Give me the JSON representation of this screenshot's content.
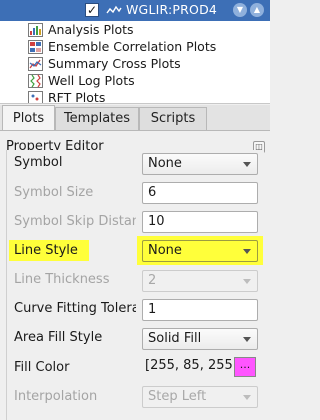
{
  "tree": {
    "selected_item": "WGLIR:PROD4",
    "selected_checked": true,
    "items": [
      {
        "label": "Analysis Plots",
        "icon": "analysis-plots-icon"
      },
      {
        "label": "Ensemble Correlation Plots",
        "icon": "correlation-plots-icon"
      },
      {
        "label": "Summary Cross Plots",
        "icon": "cross-plots-icon"
      },
      {
        "label": "Well Log Plots",
        "icon": "well-log-plots-icon"
      },
      {
        "label": "RFT Plots",
        "icon": "rft-plots-icon"
      }
    ]
  },
  "tabs": [
    {
      "label": "Plots",
      "active": true
    },
    {
      "label": "Templates",
      "active": false
    },
    {
      "label": "Scripts",
      "active": false
    }
  ],
  "property_editor": {
    "title": "Property Editor",
    "rows": {
      "symbol": {
        "label": "Symbol",
        "value": "None",
        "enabled": true
      },
      "symbol_size": {
        "label": "Symbol Size",
        "value": "6",
        "enabled": false
      },
      "symbol_skip": {
        "label": "Symbol Skip Distanc",
        "value": "10",
        "enabled": false
      },
      "line_style": {
        "label": "Line Style",
        "value": "None",
        "enabled": true,
        "highlighted": true
      },
      "line_thickness": {
        "label": "Line Thickness",
        "value": "2",
        "enabled": false
      },
      "curve_fitting": {
        "label": "Curve Fitting Toleran",
        "value": "1",
        "enabled": true
      },
      "area_fill": {
        "label": "Area Fill Style",
        "value": "Solid Fill",
        "enabled": true
      },
      "fill_color": {
        "label": "Fill Color",
        "value": "[255, 85, 255]",
        "button": "...",
        "enabled": true
      },
      "interpolation": {
        "label": "Interpolation",
        "value": "Step Left",
        "enabled": false
      }
    }
  },
  "colors": {
    "header_blue": "#3d6fb6",
    "highlight_yellow": "#ffff3a",
    "fill_color": "#ff55ff"
  }
}
